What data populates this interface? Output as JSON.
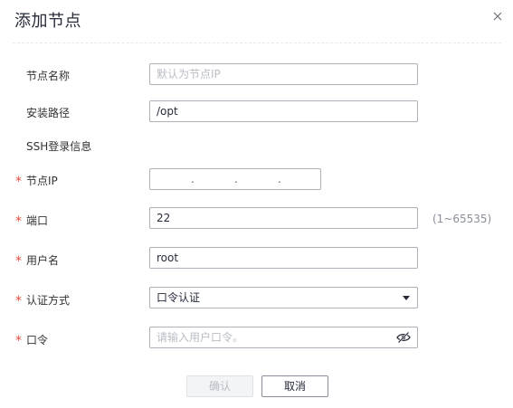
{
  "dialog": {
    "title": "添加节点",
    "close_icon": "close-icon"
  },
  "form": {
    "node_name": {
      "label": "节点名称",
      "placeholder": "默认为节点IP",
      "value": ""
    },
    "install_path": {
      "label": "安装路径",
      "value": "/opt"
    },
    "ssh_section": {
      "label": "SSH登录信息"
    },
    "node_ip": {
      "label": "节点IP",
      "required_mark": "*",
      "separator": "."
    },
    "port": {
      "label": "端口",
      "required_mark": "*",
      "value": "22",
      "hint": "(1~65535)"
    },
    "username": {
      "label": "用户名",
      "required_mark": "*",
      "value": "root"
    },
    "auth_method": {
      "label": "认证方式",
      "required_mark": "*",
      "selected": "口令认证"
    },
    "password": {
      "label": "口令",
      "required_mark": "*",
      "placeholder": "请输入用户口令。",
      "toggle_icon": "eye-off-icon"
    }
  },
  "buttons": {
    "confirm": "确认",
    "cancel": "取消"
  },
  "colors": {
    "required": "#e84a3c",
    "border": "#adb0b8",
    "placeholder": "#b8bcc4",
    "hint": "#8a8e99",
    "disabled_bg": "#f3f4f6"
  }
}
